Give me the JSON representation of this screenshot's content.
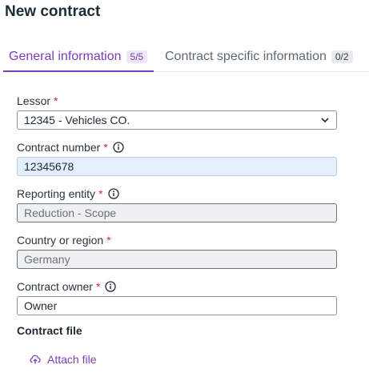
{
  "page": {
    "title": "New contract"
  },
  "tabs": [
    {
      "label": "General information",
      "badge": "5/5",
      "active": true
    },
    {
      "label": "Contract specific information",
      "badge": "0/2",
      "active": false
    }
  ],
  "form": {
    "lessor": {
      "label": "Lessor",
      "required_mark": "*",
      "value": "12345 - Vehicles CO."
    },
    "contract_number": {
      "label": "Contract number",
      "required_mark": "*",
      "value": "12345678"
    },
    "reporting_entity": {
      "label": "Reporting entity",
      "required_mark": "*",
      "value": "Reduction - Scope"
    },
    "country_region": {
      "label": "Country or region",
      "required_mark": "*",
      "value": "Germany"
    },
    "contract_owner": {
      "label": "Contract owner",
      "required_mark": "*",
      "value": "Owner"
    }
  },
  "contract_file": {
    "heading": "Contract file",
    "attach_label": "Attach file"
  },
  "colors": {
    "accent": "#7b3fb5",
    "required": "#d32f2f",
    "focused_bg": "#e6effd",
    "disabled_bg": "#eef0f2"
  },
  "icons": {
    "info": "info-icon",
    "chevron": "chevron-down-icon",
    "attach": "upload-icon"
  }
}
